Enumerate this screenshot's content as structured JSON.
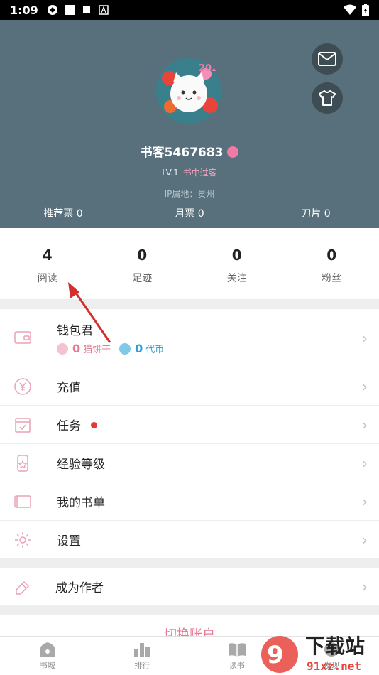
{
  "status_bar": {
    "time": "1:09"
  },
  "profile": {
    "username": "书客5467683",
    "level": "LV.1",
    "level_title": "书中过客",
    "ip_location": "IP属地：贵州",
    "tickets": [
      {
        "label": "推荐票 0"
      },
      {
        "label": "月票 0"
      },
      {
        "label": "刀片 0"
      }
    ]
  },
  "stats": [
    {
      "value": "4",
      "label": "阅读"
    },
    {
      "value": "0",
      "label": "足迹"
    },
    {
      "value": "0",
      "label": "关注"
    },
    {
      "value": "0",
      "label": "粉丝"
    }
  ],
  "wallet": {
    "title": "钱包君",
    "cat_cookie_value": "0",
    "cat_cookie_label": "猫饼干",
    "coin_value": "0",
    "coin_label": "代币"
  },
  "menu": {
    "recharge": "充值",
    "tasks": "任务",
    "exp_level": "经验等级",
    "my_booklist": "我的书单",
    "settings": "设置",
    "become_author": "成为作者"
  },
  "switch_account": "切换账户",
  "tabs": [
    {
      "label": "书城"
    },
    {
      "label": "排行"
    },
    {
      "label": "读书"
    },
    {
      "label": "发现"
    }
  ],
  "watermark": {
    "text": "下载站",
    "domain": "91xz.net"
  },
  "colors": {
    "header_bg": "#58707b",
    "accent_pink": "#e47a94",
    "coin_blue": "#2a9fd6"
  }
}
